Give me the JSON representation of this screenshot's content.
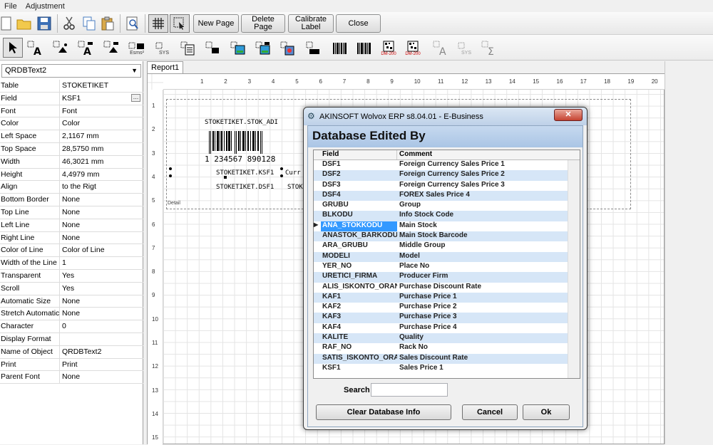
{
  "menu": [
    "File",
    "Adjustment"
  ],
  "toolbar": {
    "new_page": "New Page",
    "delete_page": "Delete Page",
    "calibrate_label": "Calibrate Label",
    "close": "Close"
  },
  "toolbar2_icons": [
    "pointer-tool-icon",
    "text-field-icon",
    "image-field-icon",
    "db-text-icon",
    "db-image-icon",
    "esms2-icon",
    "sys-icon",
    "memo-icon",
    "shape-icon",
    "richtext-icon",
    "db-richtext-icon",
    "chart-icon",
    "label-icon",
    "barcode-icon",
    "db-barcode-icon",
    "datamatrix-icon",
    "db-datamatrix-icon",
    "disabled-text-icon",
    "disabled-sys-icon",
    "sum-icon"
  ],
  "toolbar2_text": {
    "esms2": "Esms²",
    "sys": "SYS",
    "dm": "DM-200"
  },
  "object_selector": "QRDBText2",
  "properties": [
    {
      "key": "Table",
      "value": "STOKETIKET"
    },
    {
      "key": "Field",
      "value": "KSF1"
    },
    {
      "key": "Font",
      "value": "Font"
    },
    {
      "key": "Color",
      "value": "Color"
    },
    {
      "key": "Left Space",
      "value": "2,1167 mm"
    },
    {
      "key": "Top Space",
      "value": "28,5750 mm"
    },
    {
      "key": "Width",
      "value": "46,3021 mm"
    },
    {
      "key": "Height",
      "value": "4,4979 mm"
    },
    {
      "key": "Align",
      "value": "to the Rigt"
    },
    {
      "key": "Bottom Border",
      "value": "None"
    },
    {
      "key": "Top Line",
      "value": "None"
    },
    {
      "key": "Left Line",
      "value": "None"
    },
    {
      "key": "Right Line",
      "value": "None"
    },
    {
      "key": "Color of Line",
      "value": "Color of Line"
    },
    {
      "key": "Width of the Line",
      "value": "1"
    },
    {
      "key": "Transparent",
      "value": "Yes"
    },
    {
      "key": "Scroll",
      "value": "Yes"
    },
    {
      "key": "Automatic Size",
      "value": "None"
    },
    {
      "key": "Stretch Automatically",
      "value": "None"
    },
    {
      "key": "Character",
      "value": "0"
    },
    {
      "key": "Display Format",
      "value": ""
    },
    {
      "key": "Name of Object",
      "value": "QRDBText2"
    },
    {
      "key": "Print",
      "value": "Print"
    },
    {
      "key": "Parent Font",
      "value": "None"
    }
  ],
  "designer": {
    "tab": "Report1",
    "ruler_h": [
      "1",
      "2",
      "3",
      "4",
      "5",
      "6",
      "7",
      "8",
      "9",
      "10",
      "11",
      "12",
      "13",
      "14",
      "15",
      "16",
      "17",
      "18",
      "19",
      "20"
    ],
    "ruler_v": [
      "1",
      "2",
      "3",
      "4",
      "5",
      "6",
      "7",
      "8",
      "9",
      "10",
      "11",
      "12",
      "13",
      "14",
      "15"
    ],
    "band_label": "Detail",
    "stock_name_field": "STOKETIKET.STOK_ADI",
    "barcode_text": "1 234567 890128",
    "ksf1_field": "STOKETIKET.KSF1",
    "ksf1_suffix": "Curr",
    "dsf1_field": "STOKETIKET.DSF1",
    "dsf1_suffix": "STOK"
  },
  "dialog": {
    "title": "AKINSOFT Wolvox ERP s8.04.01 - E-Business",
    "close_glyph": "✕",
    "heading": "Database Edited By",
    "col_field": "Field",
    "col_comment": "Comment",
    "rows": [
      {
        "field": "DSF1",
        "comment": "Foreign Currency Sales Price 1"
      },
      {
        "field": "DSF2",
        "comment": "Foreign Currency Sales Price 2"
      },
      {
        "field": "DSF3",
        "comment": "Foreign Currency Sales Price 3"
      },
      {
        "field": "DSF4",
        "comment": "FOREX Sales Price 4"
      },
      {
        "field": "GRUBU",
        "comment": "Group"
      },
      {
        "field": "BLKODU",
        "comment": "Info Stock Code"
      },
      {
        "field": "ANA_STOKKODU",
        "comment": "Main Stock"
      },
      {
        "field": "ANASTOK_BARKODU",
        "comment": "Main Stock Barcode"
      },
      {
        "field": "ARA_GRUBU",
        "comment": "Middle Group"
      },
      {
        "field": "MODELI",
        "comment": "Model"
      },
      {
        "field": "YER_NO",
        "comment": "Place No"
      },
      {
        "field": "URETICI_FIRMA",
        "comment": "Producer Firm"
      },
      {
        "field": "ALIS_ISKONTO_ORANI",
        "comment": "Purchase Discount Rate"
      },
      {
        "field": "KAF1",
        "comment": "Purchase Price 1"
      },
      {
        "field": "KAF2",
        "comment": "Purchase Price 2"
      },
      {
        "field": "KAF3",
        "comment": "Purchase Price 3"
      },
      {
        "field": "KAF4",
        "comment": "Purchase Price 4"
      },
      {
        "field": "KALITE",
        "comment": "Quality"
      },
      {
        "field": "RAF_NO",
        "comment": "Rack No"
      },
      {
        "field": "SATIS_ISKONTO_ORANI",
        "comment": "Sales Discount Rate"
      },
      {
        "field": "KSF1",
        "comment": "Sales Price 1"
      }
    ],
    "selected_row": 6,
    "search_label": "Search",
    "search_value": "",
    "clear_button": "Clear Database Info",
    "cancel_button": "Cancel",
    "ok_button": "Ok"
  }
}
